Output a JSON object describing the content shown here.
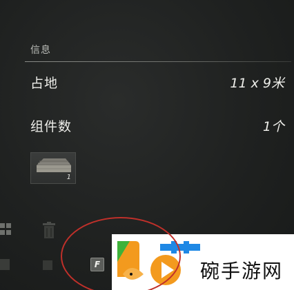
{
  "info": {
    "section_title": "信息",
    "rows": [
      {
        "label": "占地",
        "value": "11 x 9米"
      },
      {
        "label": "组件数",
        "value": "1个"
      }
    ]
  },
  "item": {
    "count": "1"
  },
  "hotkey": {
    "label": "F"
  },
  "watermark": {
    "text": "碗手游网"
  },
  "colors": {
    "background": "#1f2120",
    "highlight_circle": "#c0302a",
    "logo_orange": "#f39a1e",
    "logo_green": "#3fb23a"
  }
}
